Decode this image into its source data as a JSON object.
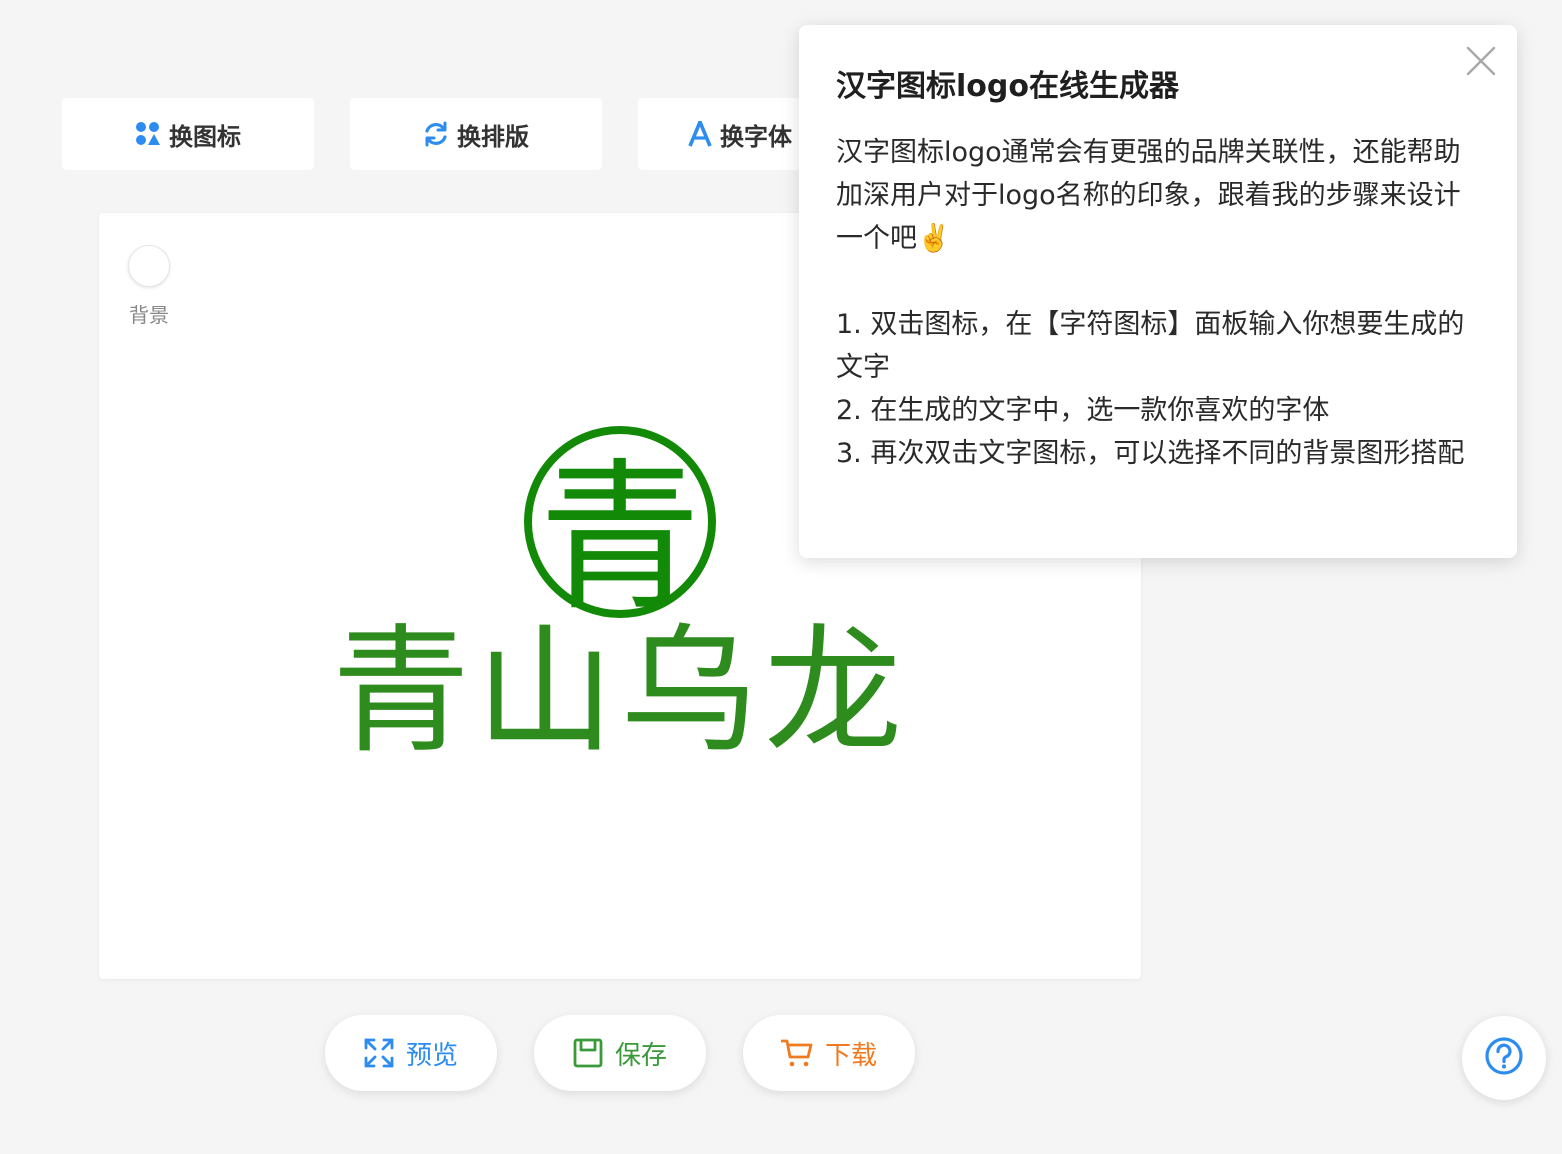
{
  "toolbar": {
    "change_icon": "换图标",
    "change_layout": "换排版",
    "change_font": "换字体"
  },
  "canvas": {
    "background_label": "背景",
    "emblem_char": "青",
    "logo_text": "青山乌龙"
  },
  "actions": {
    "preview": "预览",
    "save": "保存",
    "download": "下载"
  },
  "popover": {
    "title": "汉字图标logo在线生成器",
    "intro": "汉字图标logo通常会有更强的品牌关联性，还能帮助加深用户对于logo名称的印象，跟着我的步骤来设计一个吧✌️",
    "steps": [
      "1. 双击图标，在【字符图标】面板输入你想要生成的文字",
      "2. 在生成的文字中，选一款你喜欢的字体",
      "3. 再次双击文字图标，可以选择不同的背景图形搭配"
    ]
  },
  "icons": {
    "change_icon": "grid-dots-icon",
    "change_layout": "refresh-icon",
    "change_font": "letter-a-icon",
    "preview": "expand-icon",
    "save": "floppy-icon",
    "download": "cart-icon",
    "help": "question-circle-icon",
    "close": "close-icon"
  },
  "colors": {
    "accent_blue": "#2d8cf0",
    "logo_green": "#2e8b1e",
    "emblem_green": "#138a07",
    "save_green": "#3a9a3a",
    "download_orange": "#f07a1f"
  }
}
